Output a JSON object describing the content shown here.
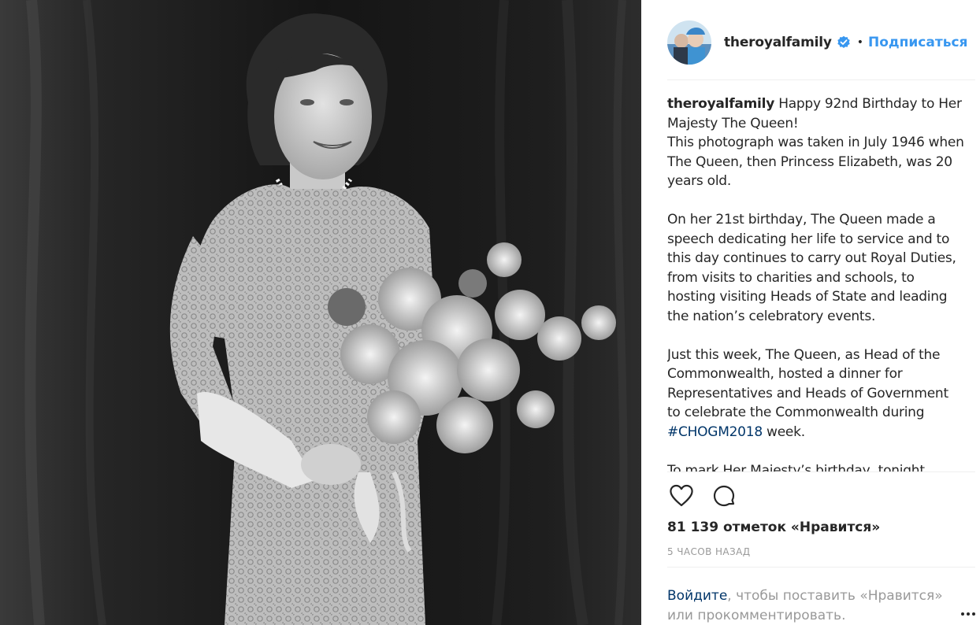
{
  "post": {
    "username": "theroyalfamily",
    "verified": true,
    "follow_label": "Подписаться",
    "dot": "•",
    "caption": {
      "username": "theroyalfamily",
      "p1": "Happy 92nd Birthday to Her Majesty The Queen!",
      "p1b": "This photograph was taken in July 1946 when The Queen, then Princess Elizabeth, was 20 years old.",
      "p2": "On her 21st birthday, The Queen made a speech dedicating her life to service and to this day continues to carry out Royal Duties, from visits to charities and schools, to hosting visiting Heads of State and leading the nation’s celebratory events.",
      "p3_pre": "Just this week, The Queen, as Head of the Commonwealth, hosted a dinner for Representatives and Heads of Government to celebrate the Commonwealth during",
      "hashtag": "#CHOGM2018",
      "p3_post": "week.",
      "p4": "To mark Her Majesty’s birthday, tonight"
    },
    "likes": "81 139 отметок «Нравится»",
    "time": "5 ЧАСОВ НАЗАД",
    "login": {
      "link": "Войдите",
      "text": ", чтобы поставить «Нравится» или прокомментировать."
    }
  },
  "icons": {
    "like": "heart-icon",
    "comment": "comment-icon",
    "verified": "verified-badge-icon",
    "more": "more-options-icon"
  },
  "colors": {
    "link": "#003569",
    "follow": "#3897f0",
    "verified": "#3897f0",
    "muted": "#999999",
    "text": "#262626"
  }
}
